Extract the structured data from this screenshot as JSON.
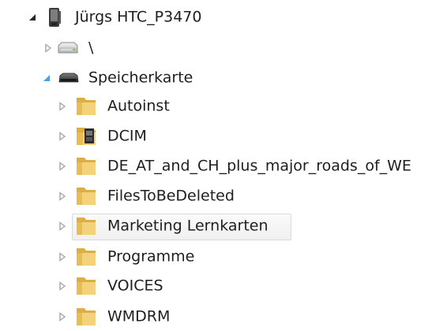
{
  "tree": {
    "device": {
      "label": "Jürgs HTC_P3470",
      "expanded": true,
      "icon": "phone-icon"
    },
    "root_drive": {
      "label": "\\",
      "expanded": false,
      "icon": "drive-icon"
    },
    "storage_card": {
      "label": "Speicherkarte",
      "expanded": true,
      "icon": "storage-card-icon"
    },
    "folders": [
      {
        "label": "Autoinst",
        "icon": "folder-icon"
      },
      {
        "label": "DCIM",
        "icon": "camera-folder-icon"
      },
      {
        "label": "DE_AT_and_CH_plus_major_roads_of_WE",
        "icon": "folder-icon"
      },
      {
        "label": "FilesToBeDeleted",
        "icon": "folder-icon"
      },
      {
        "label": "Marketing Lernkarten",
        "icon": "folder-icon",
        "hovered": true
      },
      {
        "label": "Programme",
        "icon": "folder-icon"
      },
      {
        "label": "VOICES",
        "icon": "folder-icon"
      },
      {
        "label": "WMDRM",
        "icon": "folder-icon"
      }
    ]
  },
  "colors": {
    "text": "#1e1e1e",
    "arrow_collapsed": "#a6a6a6",
    "arrow_expanded": "#262626",
    "arrow_expanded_blue": "#4aa0e8",
    "folder": "#e8c35a",
    "hover_border": "#d9d9d9"
  }
}
